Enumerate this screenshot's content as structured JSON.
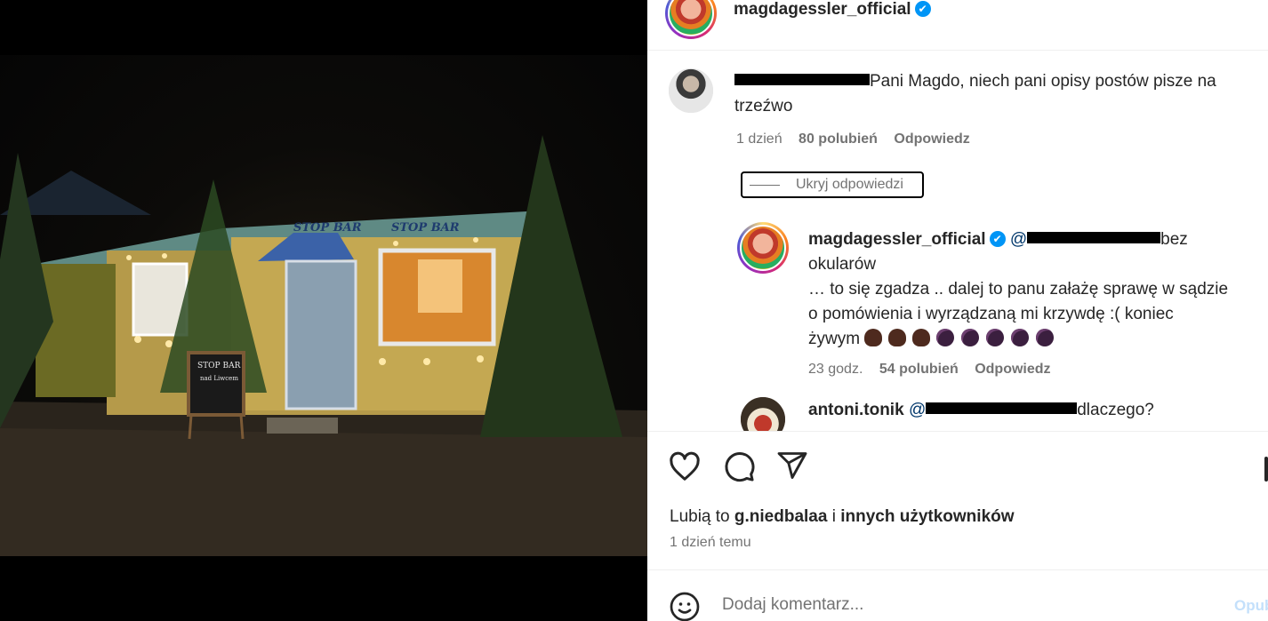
{
  "post": {
    "author": "magdagessler_official",
    "verified_mark": "✔"
  },
  "comments": [
    {
      "text": "Pani Magdo, niech pani opisy postów pisze na trzeźwo",
      "time": "1 dzień",
      "likes": "80 polubień",
      "reply_label": "Odpowiedz"
    }
  ],
  "hide_replies_label": "Ukryj odpowiedzi",
  "replies": [
    {
      "username": "magdagessler_official",
      "mention_prefix": "@",
      "text_line1_tail": "bez",
      "text_line2": "okularów",
      "text_line3": "… to się zgadza .. dalej to panu załażę sprawę w sądzie",
      "text_line4": "o pomówienia i wyrządzaną mi krzywdę :( koniec",
      "text_line5": "żywym",
      "time": "23 godz.",
      "likes": "54 polubień",
      "reply_label": "Odpowiedz"
    },
    {
      "username": "antoni.tonik",
      "mention_prefix": "@",
      "text": "dlaczego?"
    }
  ],
  "likes_summary": {
    "prefix": "Lubią to ",
    "user": "g.niedbalaa",
    "middle": " i ",
    "rest": "innych użytkowników"
  },
  "post_time": "1 dzień temu",
  "add_comment": {
    "placeholder": "Dodaj komentarz...",
    "publish_label": "Opubli"
  },
  "photo": {
    "sign_line1": "STOP BAR",
    "sign_line2": "nad Liwcem",
    "banner_text": "STOP BAR",
    "banner_sub": "nad Liwcem"
  },
  "icons": [
    "heart-icon",
    "comment-icon",
    "share-icon",
    "bookmark-icon",
    "emoji-icon",
    "verified-icon"
  ],
  "colors": {
    "accent": "#0095f6",
    "muted": "#737373",
    "text": "#262626"
  }
}
